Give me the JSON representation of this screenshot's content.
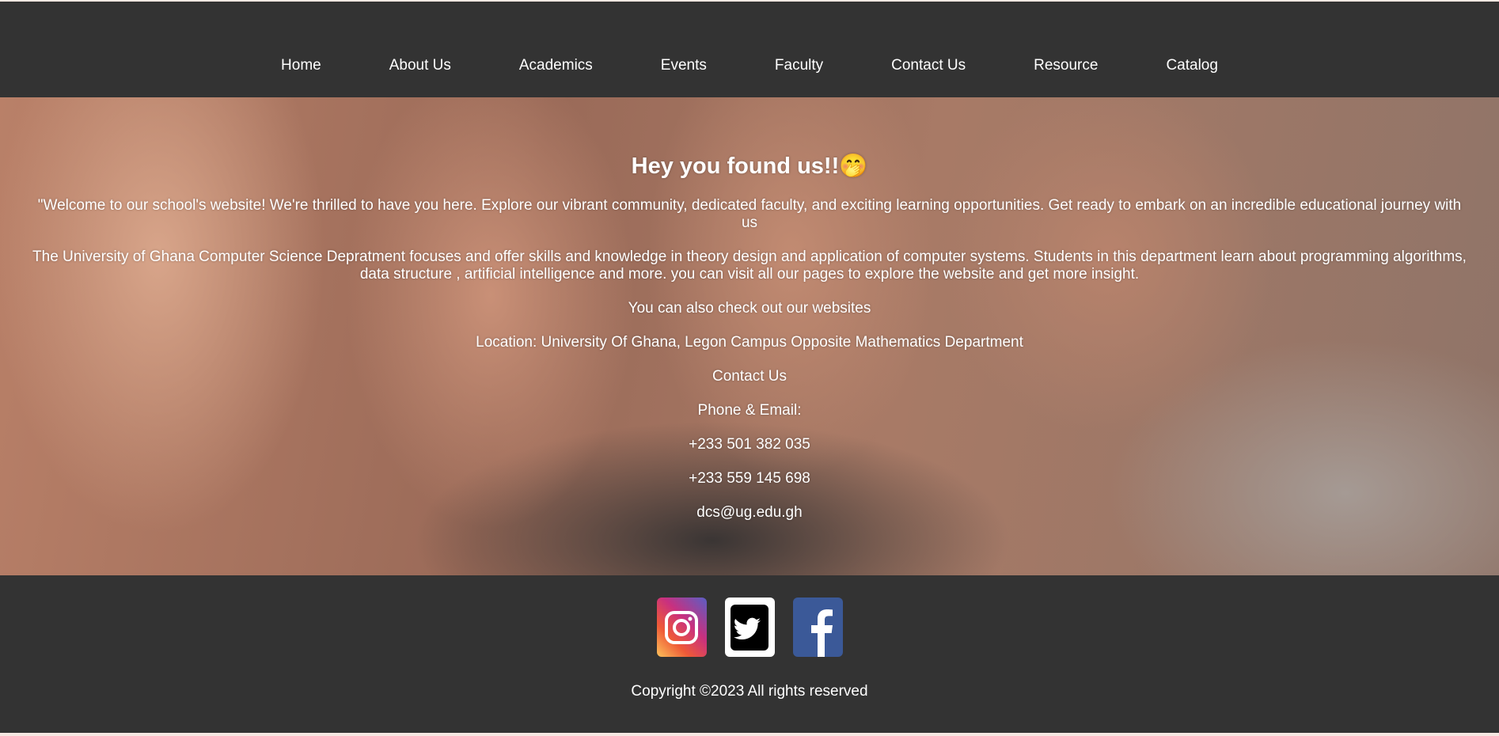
{
  "nav": {
    "items": [
      "Home",
      "About Us",
      "Academics",
      "Events",
      "Faculty",
      "Contact Us",
      "Resource",
      "Catalog"
    ]
  },
  "hero": {
    "title": "Hey you found us!!",
    "emoji": "🤭",
    "paragraphs": [
      "\"Welcome to our school's website! We're thrilled to have you here. Explore our vibrant community, dedicated faculty, and exciting learning opportunities. Get ready to embark on an incredible educational journey with us",
      "The University of Ghana Computer Science Depratment focuses and offer skills and knowledge in theory design and application of computer systems. Students in this department learn about programming algorithms, data structure , artificial intelligence and more. you can visit all our pages to explore the website and get more insight.",
      "You can also check out our websites",
      "Location: University Of Ghana, Legon Campus Opposite Mathematics Department",
      "Contact Us",
      "Phone & Email:",
      "+233 501 382 035",
      "+233 559 145 698",
      "dcs@ug.edu.gh"
    ]
  },
  "footer": {
    "social": [
      "instagram",
      "twitter",
      "facebook"
    ],
    "copyright": "Copyright ©2023 All rights reserved"
  }
}
